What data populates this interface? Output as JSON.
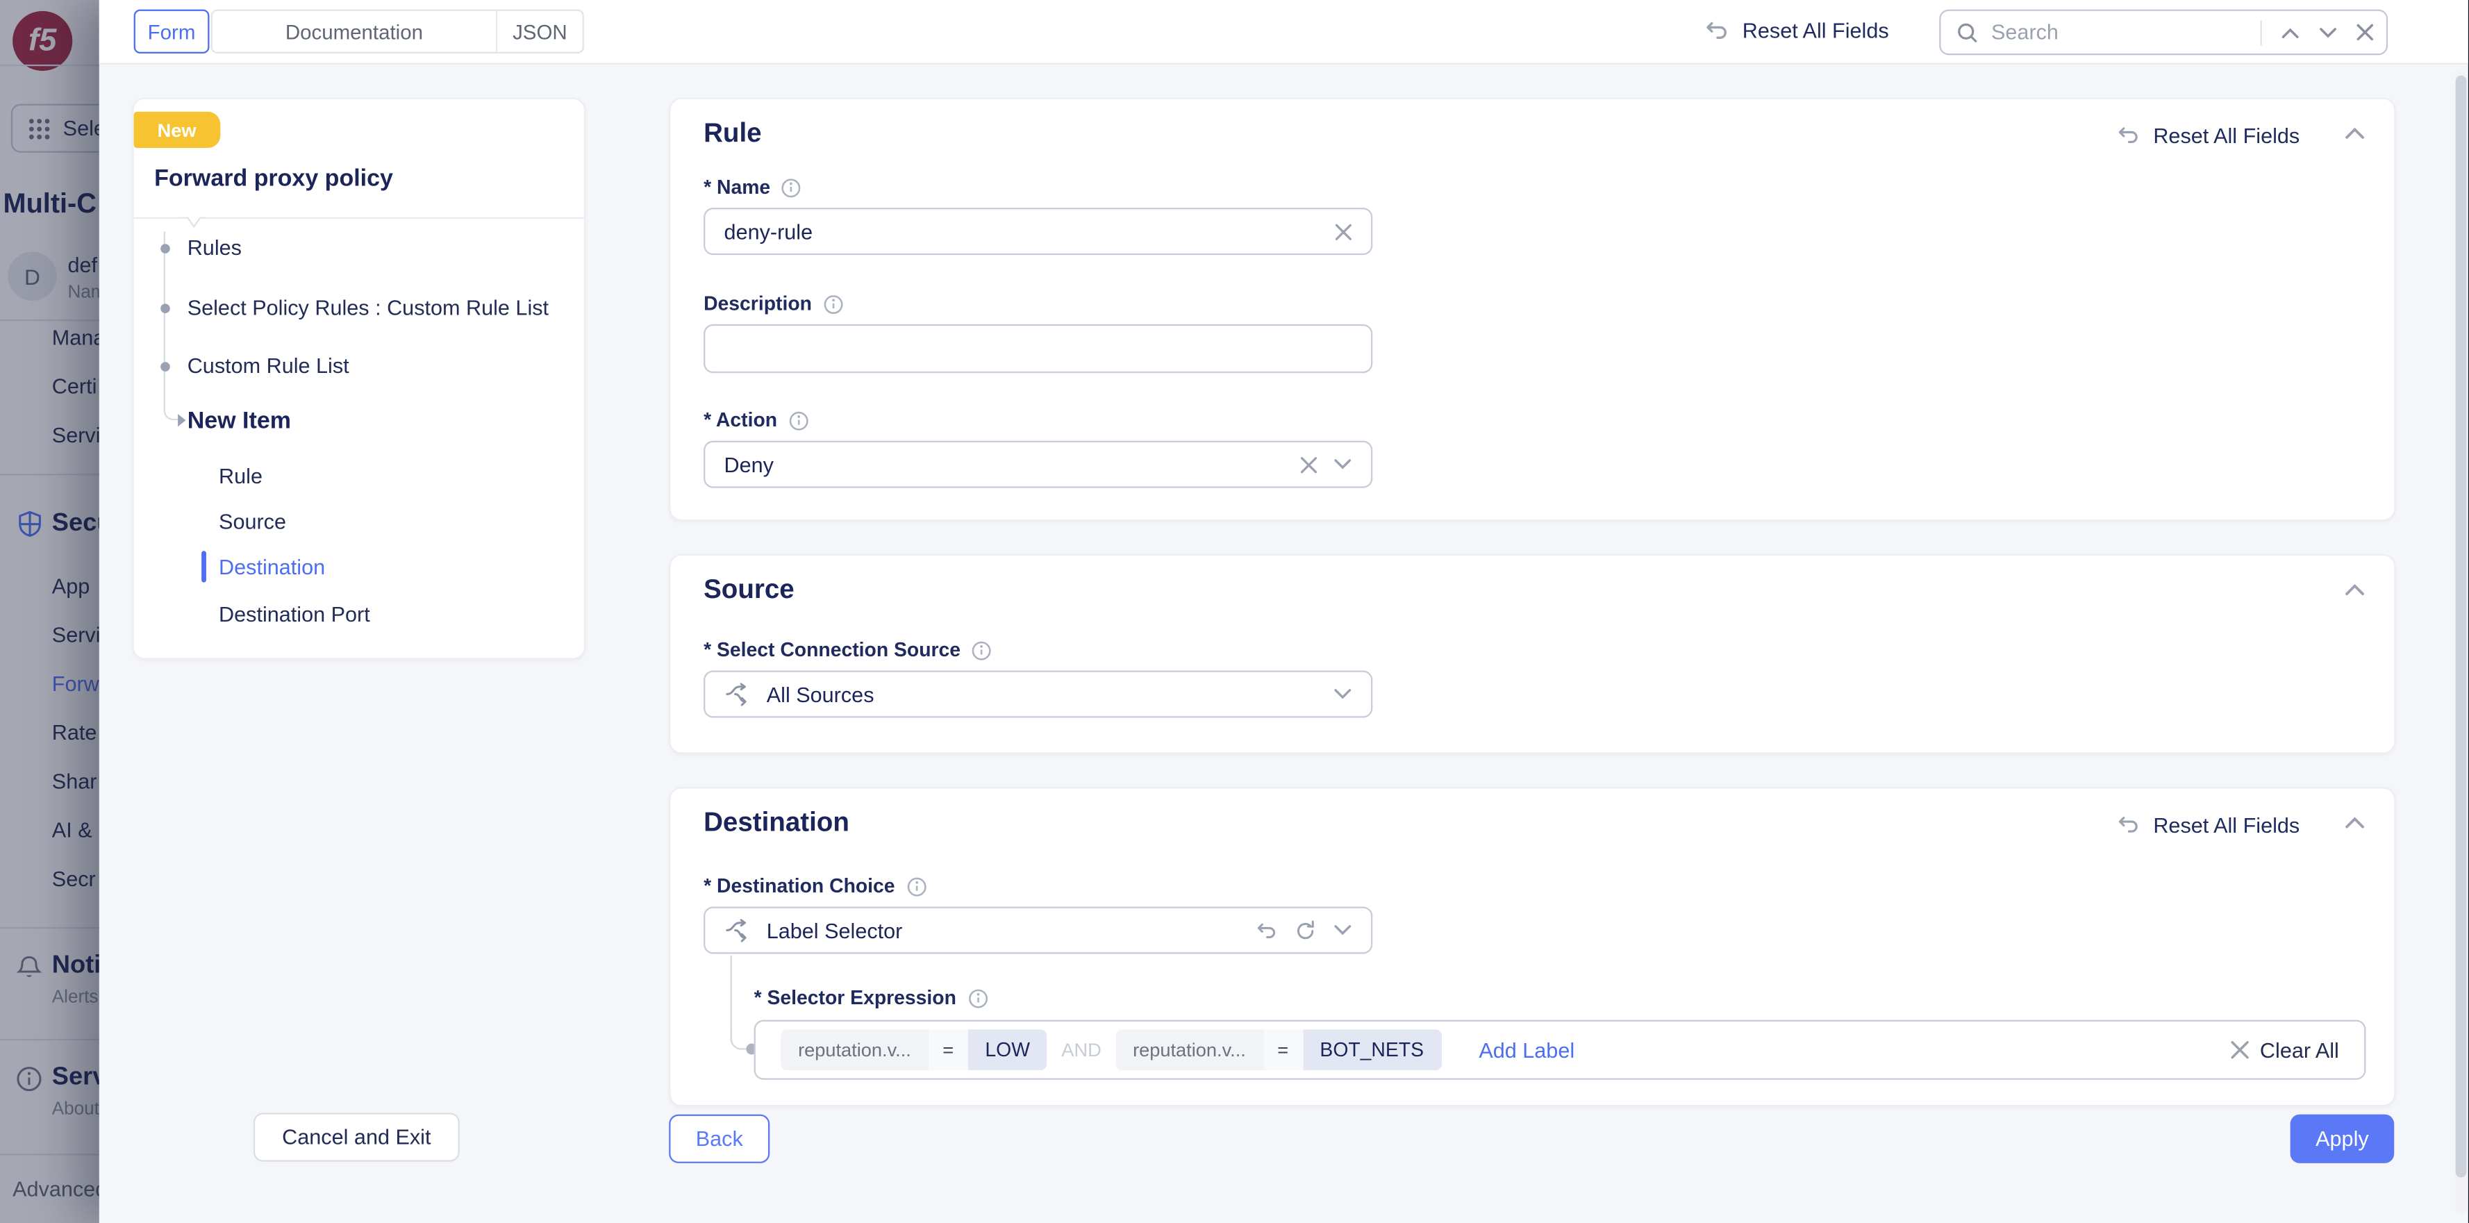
{
  "colors": {
    "accent": "#4c6ef5",
    "navy": "#1b2559",
    "badge_yellow": "#f7c331",
    "brand_red": "#a32642",
    "apply_blue": "#5b78f6"
  },
  "console": {
    "logo": "f5",
    "app_launcher": "Sele",
    "workspace_title": "Multi-C",
    "namespace": {
      "avatar": "D",
      "name": "def",
      "sub": "Nam"
    },
    "manage_items": [
      "Mana",
      "Certi",
      "Servi"
    ],
    "security": {
      "label": "Secu",
      "items": [
        "App",
        "Servi",
        "Forw",
        "Rate",
        "Shar",
        "AI &",
        "Secr"
      ],
      "active": "Forw"
    },
    "notifications": {
      "label": "Noti",
      "sub": "Alerts"
    },
    "service": {
      "label": "Serv",
      "sub": "About"
    },
    "advanced": "Advanced"
  },
  "topbar": {
    "tabs": [
      "Form",
      "Documentation",
      "JSON"
    ],
    "active_tab": "Form",
    "reset_all": "Reset All Fields",
    "search_placeholder": "Search"
  },
  "panel": {
    "badge": "New",
    "title": "Forward proxy policy",
    "tree_main": [
      "Rules",
      "Select Policy Rules : Custom Rule List",
      "Custom Rule List",
      "New Item"
    ],
    "tree_sub": [
      "Rule",
      "Source",
      "Destination",
      "Destination Port"
    ],
    "active_sub": "Destination",
    "cancel": "Cancel and Exit"
  },
  "rule": {
    "heading": "Rule",
    "reset": "Reset All Fields",
    "name_label": "* Name",
    "name_value": "deny-rule",
    "desc_label": "Description",
    "desc_value": "",
    "action_label": "* Action",
    "action_value": "Deny"
  },
  "source": {
    "heading": "Source",
    "select_label": "* Select Connection Source",
    "value": "All Sources"
  },
  "destination": {
    "heading": "Destination",
    "reset": "Reset All Fields",
    "choice_label": "* Destination Choice",
    "choice_value": "Label Selector",
    "selector_label": "* Selector Expression",
    "terms": [
      {
        "key": "reputation.v...",
        "op": "=",
        "value": "LOW"
      },
      {
        "key": "reputation.v...",
        "op": "=",
        "value": "BOT_NETS"
      }
    ],
    "joiner": "AND",
    "add_label": "Add Label",
    "clear_all": "Clear All"
  },
  "footer": {
    "back": "Back",
    "apply": "Apply"
  }
}
